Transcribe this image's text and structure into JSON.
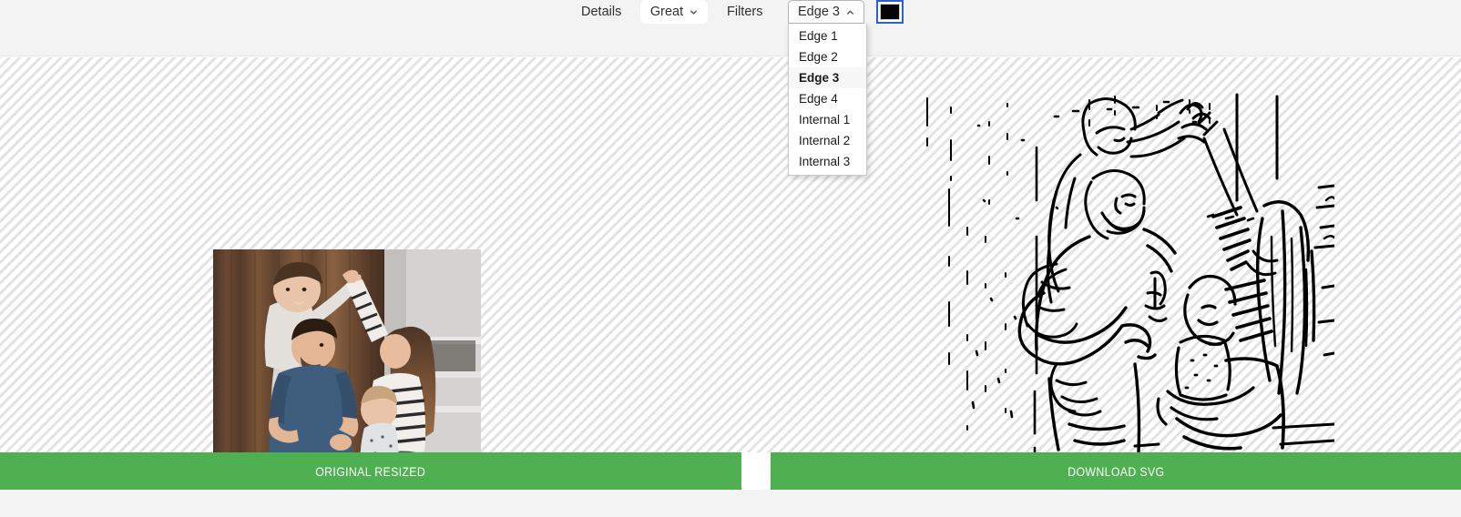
{
  "toolbar": {
    "details_label": "Details",
    "quality": {
      "value": "Great",
      "icon": "chevron-down-icon"
    },
    "filters_label": "Filters",
    "filter_select": {
      "value": "Edge 3",
      "icon": "chevron-up-icon",
      "expanded": true
    },
    "color_swatch": {
      "name": "color-swatch",
      "color": "#000000",
      "focus_ring_color": "#2b62c4"
    }
  },
  "filter_menu": {
    "selected": "Edge 3",
    "items": [
      {
        "label": "Edge 1"
      },
      {
        "label": "Edge 2"
      },
      {
        "label": "Edge 3"
      },
      {
        "label": "Edge 4"
      },
      {
        "label": "Internal 1"
      },
      {
        "label": "Internal 2"
      },
      {
        "label": "Internal 3"
      }
    ]
  },
  "canvas": {
    "left_panel": {
      "name": "original-photo-preview",
      "description": "Family photo: father carrying young boy on his shoulders high-fiving mother who is seated holding a baby, wood plank wall background"
    },
    "right_panel": {
      "name": "svg-edge-trace-preview",
      "description": "Black line-art edge trace of the same family photo rendered on transparent checkered background"
    }
  },
  "actions": {
    "original_resized_label": "ORIGINAL RESIZED",
    "download_svg_label": "DOWNLOAD SVG",
    "green": "#4eb050"
  }
}
